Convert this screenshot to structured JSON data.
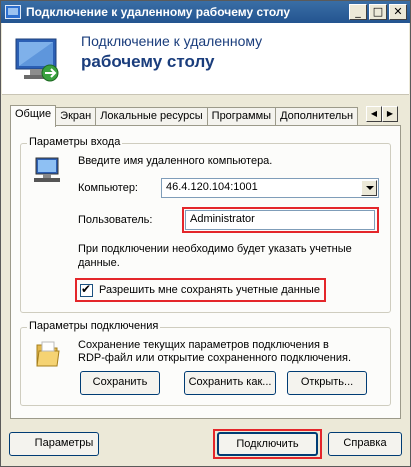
{
  "window": {
    "title": "Подключение к удаленному рабочему столу",
    "min_glyph": "_",
    "max_glyph": "□",
    "close_glyph": "✕"
  },
  "header": {
    "line1": "Подключение к удаленному",
    "line2": "рабочему столу",
    "icon": "remote-desktop-monitor-icon"
  },
  "tabs": [
    {
      "label": "Общие",
      "active": true
    },
    {
      "label": "Экран",
      "active": false
    },
    {
      "label": "Локальные ресурсы",
      "active": false
    },
    {
      "label": "Программы",
      "active": false
    },
    {
      "label": "Дополнительн",
      "active": false
    }
  ],
  "tab_scroll": {
    "left": "◀",
    "right": "▶"
  },
  "login_group": {
    "title": "Параметры входа",
    "prompt": "Введите имя удаленного компьютера.",
    "computer_label": "Компьютер:",
    "computer_value": "46.4.120.104:1001",
    "user_label": "Пользователь:",
    "user_value": "Administrator",
    "note_line1": "При подключении необходимо будет указать учетные",
    "note_line2": "данные.",
    "save_credentials_label": "Разрешить мне сохранять учетные данные",
    "save_credentials_checked": true
  },
  "connection_group": {
    "title": "Параметры подключения",
    "desc_line1": "Сохранение текущих параметров подключения в",
    "desc_line2": "RDP-файл или открытие сохраненного подключения.",
    "save_button": "Сохранить",
    "save_as_button": "Сохранить как...",
    "open_button": "Открыть..."
  },
  "footer": {
    "options_button": "Параметры",
    "connect_button": "Подключить",
    "help_button": "Справка"
  },
  "colors": {
    "highlight": "#e4262a",
    "title_text": "#1a3d7c"
  }
}
